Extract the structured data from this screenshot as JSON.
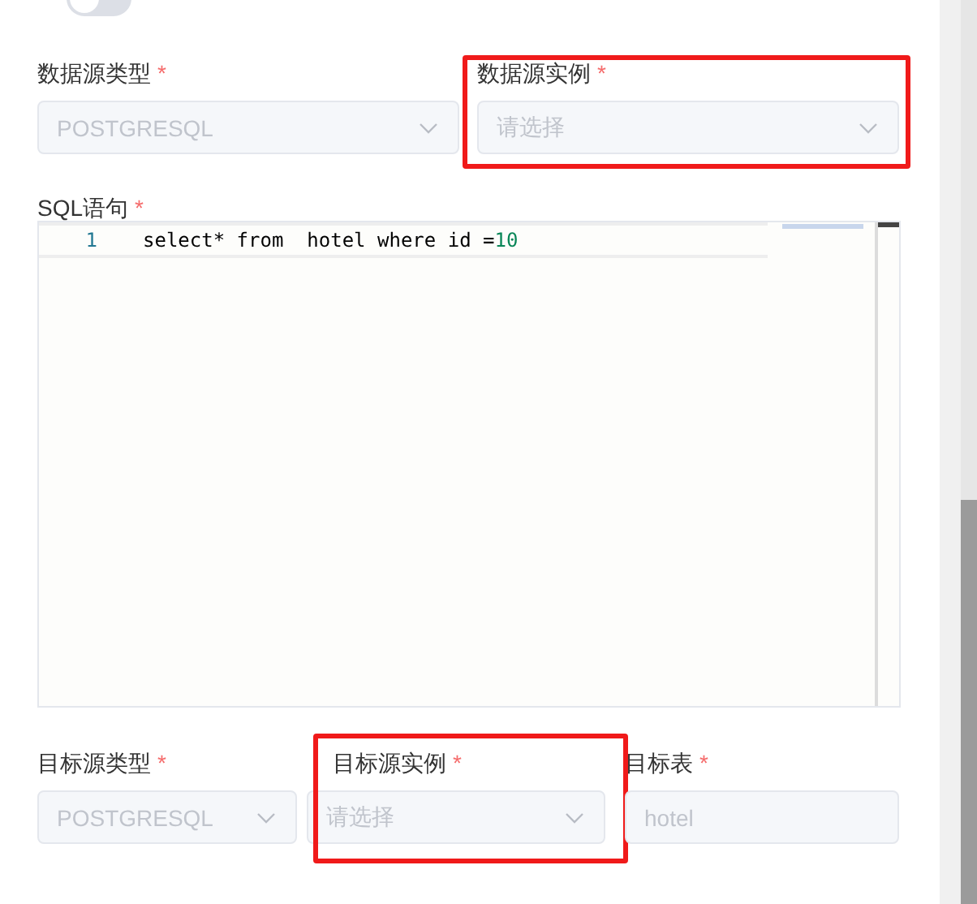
{
  "toggle": {
    "on": false
  },
  "source_row": [
    {
      "label": "数据源类型",
      "required_mark": "*",
      "value": "POSTGRESQL",
      "kind": "select",
      "disabled": true,
      "highlighted": false
    },
    {
      "label": "数据源实例",
      "required_mark": "*",
      "placeholder": "请选择",
      "kind": "select",
      "disabled": true,
      "highlighted": true
    }
  ],
  "sql": {
    "label": "SQL语句",
    "required_mark": "*",
    "lines": [
      {
        "number": "1",
        "tokens": [
          {
            "text": "select* from  hotel where id =",
            "kind": "plain"
          },
          {
            "text": "10",
            "kind": "number"
          }
        ]
      }
    ]
  },
  "target_row": [
    {
      "label": "目标源类型",
      "required_mark": "*",
      "value": "POSTGRESQL",
      "kind": "select",
      "disabled": true,
      "highlighted": false
    },
    {
      "label": "目标源实例",
      "required_mark": "*",
      "placeholder": "请选择",
      "kind": "select",
      "disabled": true,
      "highlighted": true
    },
    {
      "label": "目标表",
      "required_mark": "*",
      "value": "hotel",
      "kind": "input",
      "disabled": true,
      "highlighted": false
    }
  ]
}
